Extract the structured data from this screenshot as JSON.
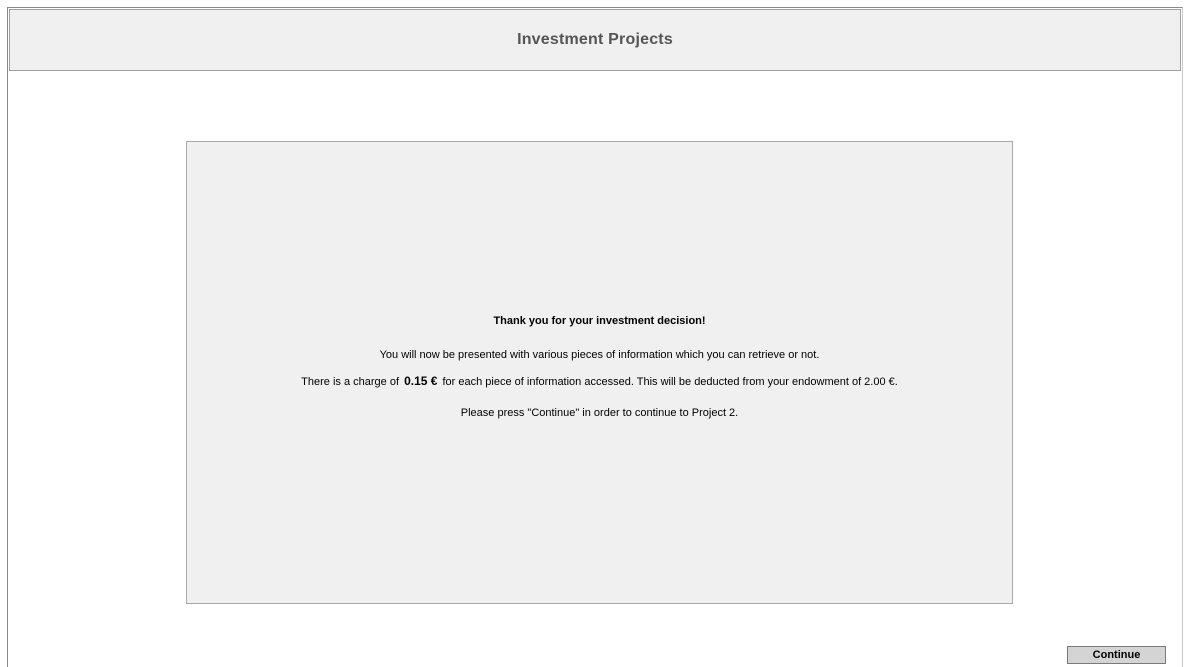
{
  "header": {
    "title": "Investment Projects"
  },
  "panel": {
    "heading": "Thank you for your investment decision!",
    "line1": "You will now be presented with various pieces of information which you can retrieve or not.",
    "line2_prefix": "There is a charge of ",
    "line2_amount": "0.15 €",
    "line2_suffix": " for each piece of information accessed. This will be deducted from your endowment of 2.00 €.",
    "line3": "Please press \"Continue\" in order to continue to Project 2."
  },
  "footer": {
    "continue_label": "Continue"
  },
  "colors": {
    "panel_background": "#f0f0f0",
    "header_title": "#555555",
    "button_background": "#d4d4d4"
  }
}
